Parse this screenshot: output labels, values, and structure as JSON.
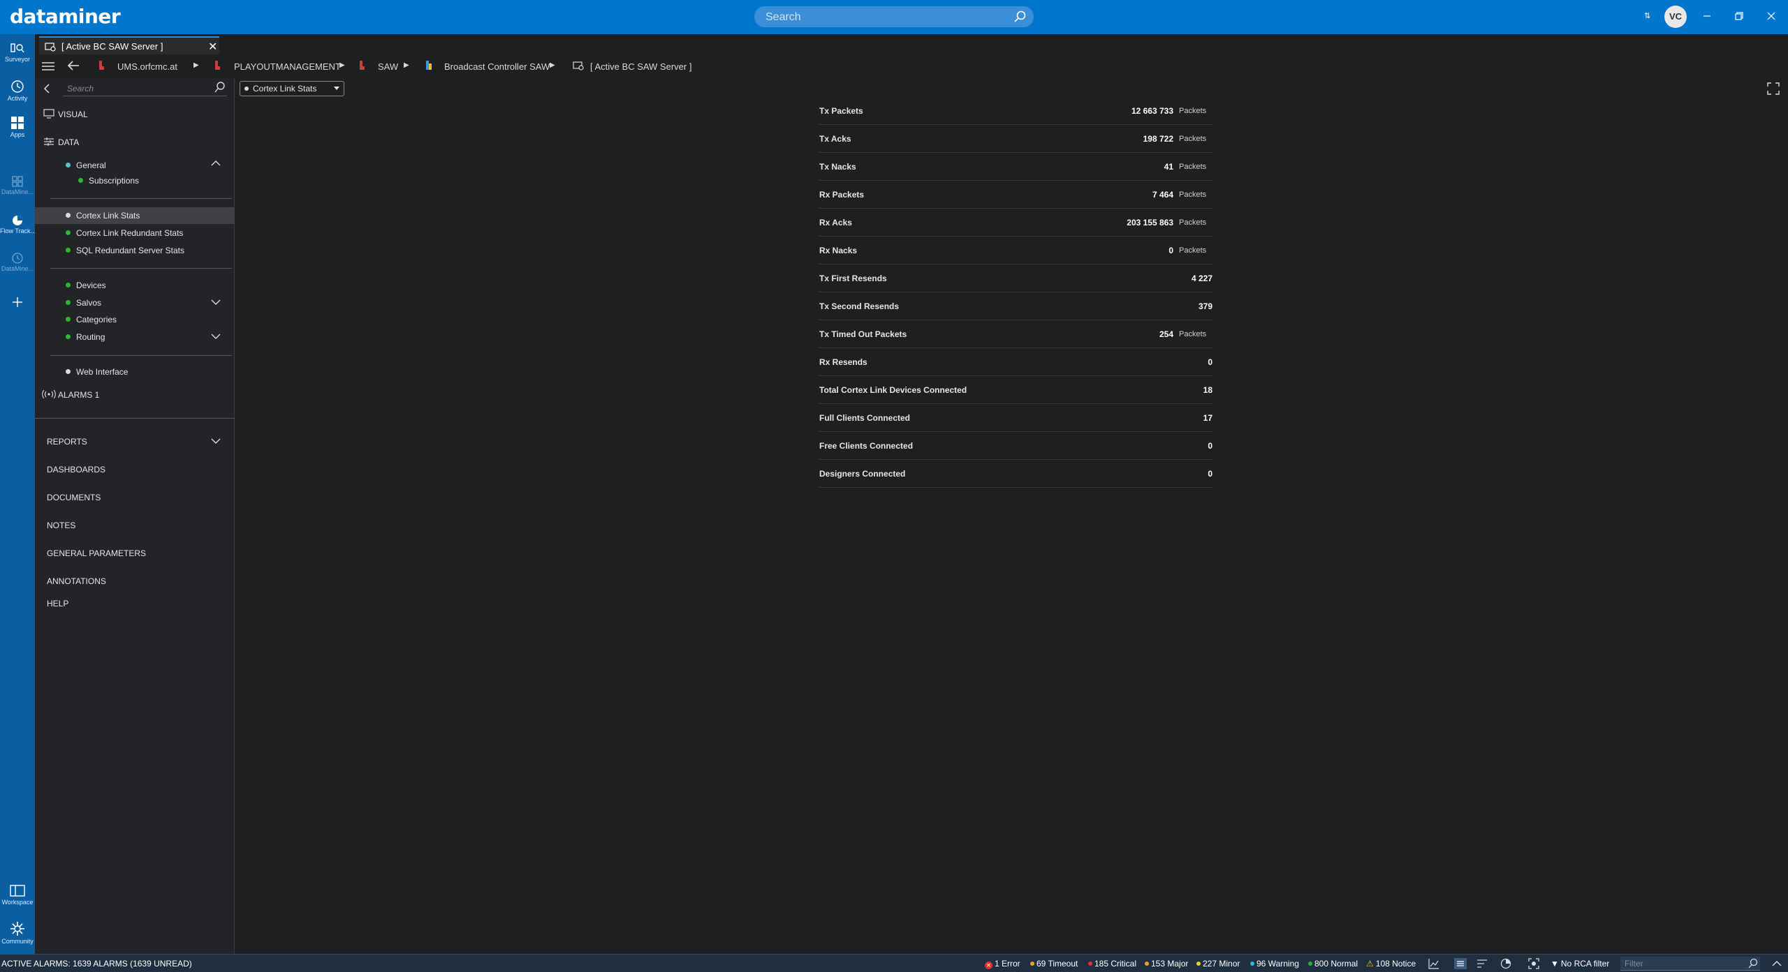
{
  "app": {
    "brand": "dataminer"
  },
  "topbar": {
    "search_placeholder": "Search",
    "avatar_initials": "VC"
  },
  "rail": [
    {
      "label": "Surveyor",
      "icon": "surveyor-icon"
    },
    {
      "label": "Activity",
      "icon": "activity-icon"
    },
    {
      "label": "Apps",
      "icon": "apps-icon"
    },
    {
      "label": "DataMine...",
      "icon": "datamine-apps-icon"
    },
    {
      "label": "Flow Track...",
      "icon": "flow-tracking-icon"
    },
    {
      "label": "DataMine...",
      "icon": "datamine-history-icon"
    },
    {
      "label": "Workspace",
      "icon": "workspace-icon"
    },
    {
      "label": "Community",
      "icon": "community-icon"
    }
  ],
  "tab": {
    "title": "[ Active BC SAW Server ]"
  },
  "breadcrumb": {
    "items": [
      "UMS.orfcmc.at",
      "PLAYOUTMANAGEMENT",
      "SAW",
      "Broadcast Controller SAW",
      "[ Active BC SAW Server ]"
    ]
  },
  "sidebar": {
    "search_placeholder": "Search",
    "visual": "VISUAL",
    "data": "DATA",
    "general": "General",
    "subscriptions": "Subscriptions",
    "cortex_link_stats": "Cortex Link Stats",
    "cortex_link_redundant_stats": "Cortex Link Redundant Stats",
    "sql_redundant_server_stats": "SQL Redundant Server Stats",
    "devices": "Devices",
    "salvos": "Salvos",
    "categories": "Categories",
    "routing": "Routing",
    "web_interface": "Web Interface",
    "alarms": "ALARMS 1",
    "reports": "REPORTS",
    "dashboards": "DASHBOARDS",
    "documents": "DOCUMENTS",
    "notes": "NOTES",
    "general_parameters": "GENERAL PARAMETERS",
    "annotations": "ANNOTATIONS",
    "help": "HELP"
  },
  "content": {
    "page_select": "Cortex Link Stats",
    "parameters": [
      {
        "name": "Tx Packets",
        "value": "12 663 733",
        "unit": "Packets"
      },
      {
        "name": "Tx Acks",
        "value": "198 722",
        "unit": "Packets"
      },
      {
        "name": "Tx Nacks",
        "value": "41",
        "unit": "Packets"
      },
      {
        "name": "Rx Packets",
        "value": "7 464",
        "unit": "Packets"
      },
      {
        "name": "Rx Acks",
        "value": "203 155 863",
        "unit": "Packets"
      },
      {
        "name": "Rx Nacks",
        "value": "0",
        "unit": "Packets"
      },
      {
        "name": "Tx First Resends",
        "value": "4 227",
        "unit": ""
      },
      {
        "name": "Tx Second Resends",
        "value": "379",
        "unit": ""
      },
      {
        "name": "Tx Timed Out Packets",
        "value": "254",
        "unit": "Packets"
      },
      {
        "name": "Rx Resends",
        "value": "0",
        "unit": ""
      },
      {
        "name": "Total Cortex Link Devices Connected",
        "value": "18",
        "unit": ""
      },
      {
        "name": "Full Clients Connected",
        "value": "17",
        "unit": ""
      },
      {
        "name": "Free Clients Connected",
        "value": "0",
        "unit": ""
      },
      {
        "name": "Designers Connected",
        "value": "0",
        "unit": ""
      }
    ]
  },
  "statusbar": {
    "active_alarms": "ACTIVE ALARMS: 1639 ALARMS (1639 UNREAD)",
    "error": "1 Error",
    "timeout": "69 Timeout",
    "critical": "185 Critical",
    "major": "153 Major",
    "minor": "227 Minor",
    "warning": "96 Warning",
    "normal": "800 Normal",
    "notice": "108 Notice",
    "rca_filter": "No RCA filter",
    "filter_placeholder": "Filter",
    "colors": {
      "error": "#e03030",
      "timeout": "#f0a020",
      "critical": "#e03030",
      "major": "#f0a020",
      "minor": "#e8d020",
      "warning": "#30b8e0",
      "normal": "#30b030",
      "notice": "#f0c020"
    }
  }
}
